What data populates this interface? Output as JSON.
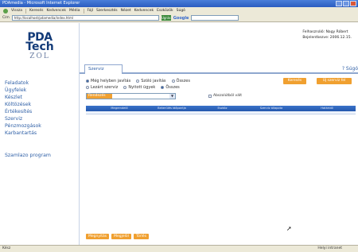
{
  "window": {
    "title": "PDAmedia - Microsoft Internet Explorer"
  },
  "menu": [
    "Vissza",
    "Keresés",
    "Kedvencek",
    "Média",
    "Fájl",
    "Szerkesztés",
    "Nézet",
    "Kedvencek",
    "Eszközök",
    "Súgó"
  ],
  "address": {
    "label": "Cím",
    "url": "http://localhost/pdamedia/index.html",
    "go": "Ugrás",
    "google": "Google"
  },
  "app": {
    "logo": {
      "line1": "PDA",
      "line2": "Tech",
      "line3": "ZOL"
    },
    "user": {
      "line1": "Felhasználó: Nagy Róbert",
      "line2": "Bejelentkezve: 2006.12.15."
    },
    "nav": [
      "Feladatok",
      "Ügyfelek",
      "Készlet",
      "Költözések",
      "Értékesítés",
      "Szerviz",
      "Pénzmozgások",
      "Karbantartás"
    ],
    "program": "Szamlazo program",
    "tab": "Szerviz",
    "help": "? Súgó",
    "filters": {
      "row1": [
        "Még helyben javítás",
        "Szóló javítás",
        "Összes"
      ],
      "row2": [
        "Lezárt szerviz",
        "Nyitott ügyek",
        "Összes"
      ]
    },
    "select_value": "Rendezés",
    "checkbox_label": "Abszolútból vált",
    "buttons": {
      "top1": "Keresés",
      "top2": "Új szerviz fel"
    },
    "columns": [
      "",
      "Megrendelő",
      "Bekerülés időpontja",
      "Eszköz",
      "Szerviz állapota",
      "Határidő"
    ],
    "bottom_buttons": [
      "Megnyitás",
      "Megjelöl",
      "Törlés"
    ]
  },
  "status": {
    "left": "Kész",
    "right": "Helyi intranet"
  }
}
